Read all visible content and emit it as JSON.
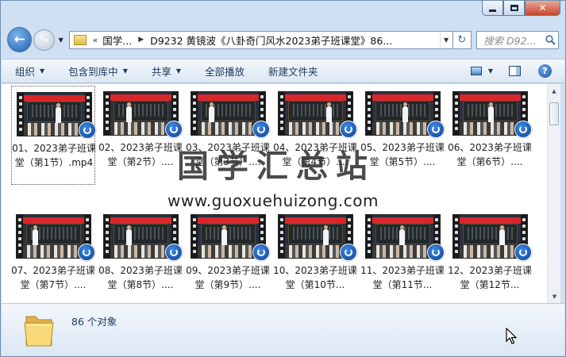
{
  "window": {
    "caption": {
      "minimize": "minimize",
      "maximize": "maximize",
      "close": "✕"
    }
  },
  "address": {
    "segments": [
      "国学...",
      "D9232 黄镜波《八卦奇门风水2023弟子班课堂》86..."
    ]
  },
  "search": {
    "placeholder": "搜索 D92..."
  },
  "toolbar": {
    "organize": "组织",
    "include_library": "包含到库中",
    "share": "共享",
    "play_all": "全部播放",
    "new_folder": "新建文件夹"
  },
  "files": [
    {
      "name": "01、2023弟子班课堂（第1节）.mp4",
      "selected": true
    },
    {
      "name": "02、2023弟子班课堂（第2节）...."
    },
    {
      "name": "03、2023弟子班课堂（第3节）...."
    },
    {
      "name": "04、2023弟子班课堂（第4节）...."
    },
    {
      "name": "05、2023弟子班课堂（第5节）...."
    },
    {
      "name": "06、2023弟子班课堂（第6节）...."
    },
    {
      "name": "07、2023弟子班课堂（第7节）...."
    },
    {
      "name": "08、2023弟子班课堂（第8节）...."
    },
    {
      "name": "09、2023弟子班课堂（第9节）...."
    },
    {
      "name": "10、2023弟子班课堂（第10节..."
    },
    {
      "name": "11、2023弟子班课堂（第11节..."
    },
    {
      "name": "12、2023弟子班课堂（第12节..."
    }
  ],
  "watermark": {
    "title": "国学汇总站",
    "url": "www.guoxuehuizong.com"
  },
  "details": {
    "count": "86 个对象"
  },
  "icons": {
    "back": "back-arrow-icon",
    "forward": "forward-arrow-icon",
    "search": "magnifier-icon",
    "help": "question-mark-icon"
  }
}
